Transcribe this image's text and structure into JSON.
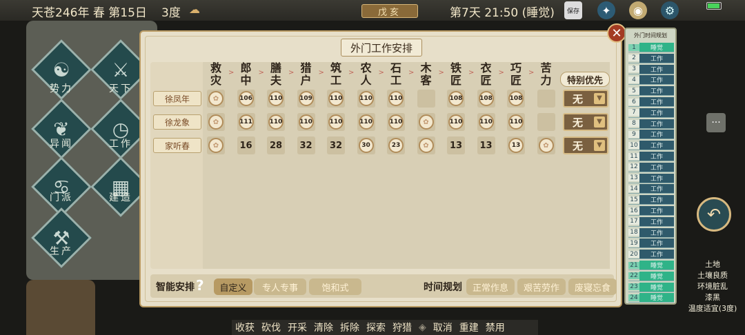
{
  "status": {
    "date": "天苍246年 春 第15日",
    "temperature": "3度",
    "ganzhi": "戊亥",
    "time": "第7天 21:50 (睡觉)",
    "save_label": "保存"
  },
  "sidebar": [
    {
      "label": "势力"
    },
    {
      "label": "天下"
    },
    {
      "label": "异闻"
    },
    {
      "label": "工作"
    },
    {
      "label": "门派"
    },
    {
      "label": "建造"
    },
    {
      "label": "生产"
    }
  ],
  "bottom_actions": [
    "收获",
    "砍伐",
    "开采",
    "清除",
    "拆除",
    "探索",
    "狩猎",
    "",
    "取消",
    "重建",
    "禁用"
  ],
  "panel": {
    "title": "外门工作安排",
    "priority_header": "特别优先",
    "jobs": [
      "救灾",
      "郎中",
      "膳夫",
      "猎户",
      "筑工",
      "农人",
      "石工",
      "木客",
      "铁匠",
      "衣匠",
      "巧匠",
      "苦力"
    ],
    "workers": [
      {
        "name": "徐凤年",
        "priority": "无",
        "cells": [
          [
            "p",
            ""
          ],
          [
            "c",
            "106"
          ],
          [
            "c",
            "110"
          ],
          [
            "c",
            "109"
          ],
          [
            "c",
            "110"
          ],
          [
            "c",
            "110"
          ],
          [
            "t",
            "110"
          ],
          [
            "e",
            ""
          ],
          [
            "c",
            "108"
          ],
          [
            "c",
            "108"
          ],
          [
            "c",
            "108"
          ],
          [
            "e",
            ""
          ]
        ]
      },
      {
        "name": "徐龙象",
        "priority": "无",
        "cells": [
          [
            "p",
            ""
          ],
          [
            "c",
            "111"
          ],
          [
            "c",
            "110"
          ],
          [
            "c",
            "110"
          ],
          [
            "c",
            "110"
          ],
          [
            "c",
            "110"
          ],
          [
            "c",
            "110"
          ],
          [
            "p",
            ""
          ],
          [
            "c",
            "110"
          ],
          [
            "c",
            "110"
          ],
          [
            "c",
            "110"
          ],
          [
            "e",
            ""
          ]
        ]
      },
      {
        "name": "家听春",
        "priority": "无",
        "cells": [
          [
            "p",
            ""
          ],
          [
            "n",
            "16"
          ],
          [
            "n",
            "28"
          ],
          [
            "n",
            "32"
          ],
          [
            "n",
            "32"
          ],
          [
            "c",
            "30"
          ],
          [
            "c",
            "23"
          ],
          [
            "p",
            ""
          ],
          [
            "n",
            "13"
          ],
          [
            "n",
            "13"
          ],
          [
            "c",
            "13"
          ],
          [
            "p",
            ""
          ]
        ]
      }
    ],
    "smart_label": "智能安排",
    "smart_options": [
      "自定义",
      "专人专事",
      "饱和式"
    ],
    "schedule_label": "时间规划",
    "schedule_options": [
      "正常作息",
      "艰苦劳作",
      "废寝忘食"
    ]
  },
  "time_schedule": {
    "title": "外门时间规划",
    "rows": [
      {
        "h": "1",
        "a": "睡觉"
      },
      {
        "h": "2",
        "a": "工作"
      },
      {
        "h": "3",
        "a": "工作"
      },
      {
        "h": "4",
        "a": "工作"
      },
      {
        "h": "5",
        "a": "工作"
      },
      {
        "h": "6",
        "a": "工作"
      },
      {
        "h": "7",
        "a": "工作"
      },
      {
        "h": "8",
        "a": "工作"
      },
      {
        "h": "9",
        "a": "工作"
      },
      {
        "h": "10",
        "a": "工作"
      },
      {
        "h": "11",
        "a": "工作"
      },
      {
        "h": "12",
        "a": "工作"
      },
      {
        "h": "13",
        "a": "工作"
      },
      {
        "h": "14",
        "a": "工作"
      },
      {
        "h": "15",
        "a": "工作"
      },
      {
        "h": "16",
        "a": "工作"
      },
      {
        "h": "17",
        "a": "工作"
      },
      {
        "h": "18",
        "a": "工作"
      },
      {
        "h": "19",
        "a": "工作"
      },
      {
        "h": "20",
        "a": "工作"
      },
      {
        "h": "21",
        "a": "睡觉"
      },
      {
        "h": "22",
        "a": "睡觉"
      },
      {
        "h": "23",
        "a": "睡觉"
      },
      {
        "h": "24",
        "a": "睡觉"
      }
    ]
  },
  "terrain": [
    "土地",
    "土壤良质",
    "环境脏乱",
    "漆黑",
    "温度适宜(3度)"
  ],
  "icons": {
    "battery": "battery-icon",
    "settings": "gear-icon",
    "save": "save-icon",
    "chat": "chat-icon",
    "back": "back-arrow-icon",
    "close": "close-icon"
  }
}
